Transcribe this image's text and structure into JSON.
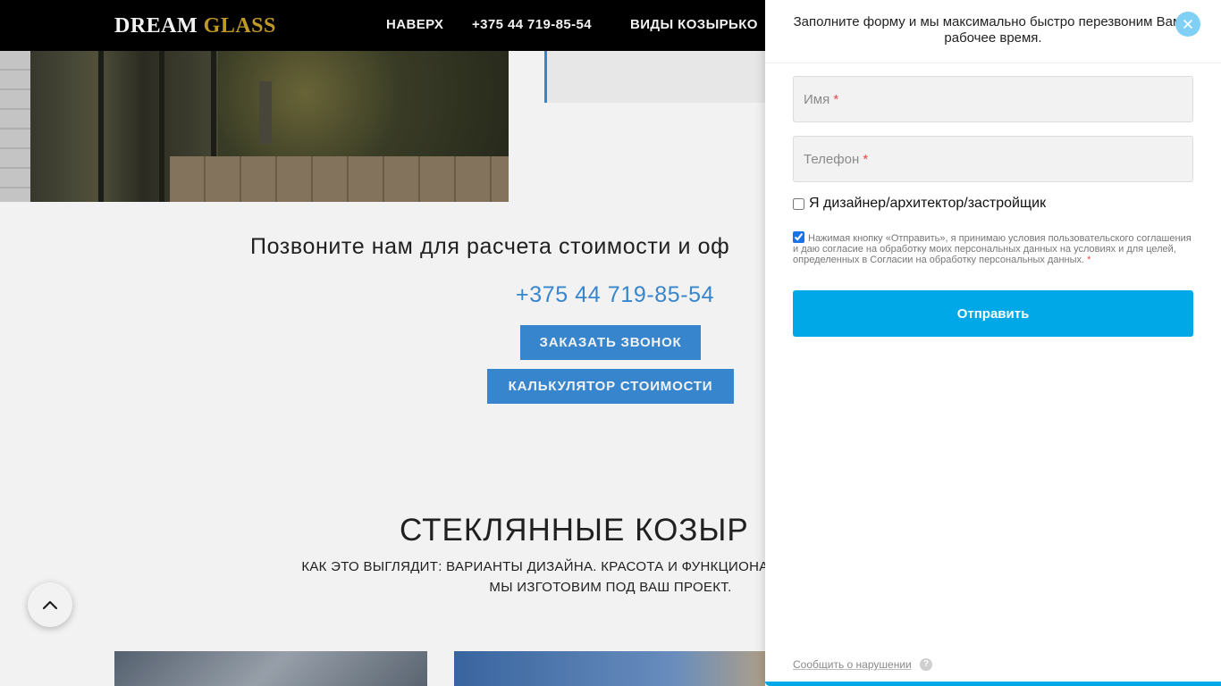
{
  "site": {
    "logo_word1": "DREAM",
    "logo_word2": "GLASS",
    "nav": {
      "top": "НАВЕРХ",
      "phone": "+375 44 719-85-54",
      "types": "ВИДЫ КОЗЫРЬКО"
    }
  },
  "call_section": {
    "title": "Позвоните нам для расчета стоимости и оф",
    "phone": "+375 44 719-85-54",
    "order_button": "ЗАКАЗАТЬ ЗВОНОК",
    "calc_button": "КАЛЬКУЛЯТОР СТОИМОСТИ"
  },
  "gallery_section": {
    "title": "СТЕКЛЯННЫЕ КОЗЫР",
    "subtitle_line1": "КАК ЭТО ВЫГЛЯДИТ: ВАРИАНТЫ ДИЗАЙНА. КРАСОТА И ФУНКЦИОНАЛЬНОСТЬ В ЛЮБОМ С",
    "subtitle_line2": "МЫ ИЗГОТОВИМ ПОД ВАШ ПРОЕКТ."
  },
  "form_panel": {
    "header": "Заполните форму и мы максимально быстро перезвоним Вам в рабочее время.",
    "name_placeholder": "Имя",
    "phone_placeholder": "Телефон",
    "required_mark": "*",
    "designer_checkbox": {
      "label": "Я дизайнер/архитектор/застройщик",
      "checked": false
    },
    "consent": {
      "text": "Нажимая кнопку «Отправить», я принимаю условия пользовательского соглашения и даю согласие на обработку моих персональных данных на условиях и для целей, определенных в Согласии на обработку персональных данных.",
      "checked": true
    },
    "submit_label": "Отправить",
    "report_link": "Сообщить о нарушении",
    "help_glyph": "?"
  },
  "icons": {
    "close": "close-icon",
    "scroll_top": "chevron-up-icon",
    "help": "help-icon"
  },
  "colors": {
    "accent": "#00a8e8",
    "page_accent": "#3a8ed8",
    "logo_gold": "#c9a227",
    "close_button": "#7fd0f4",
    "required": "#e5484d"
  }
}
